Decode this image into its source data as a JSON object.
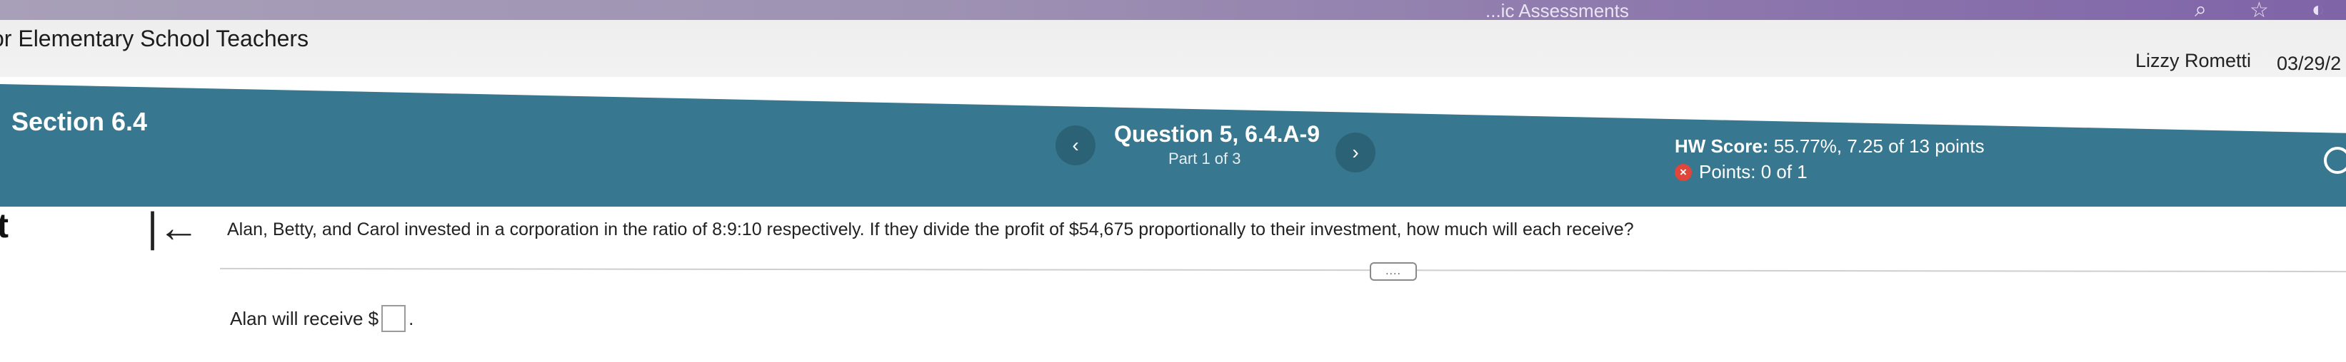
{
  "browser": {
    "tab_fragment": "...ic Assessments",
    "icons": [
      "search-icon",
      "star-icon",
      "extension-icon"
    ]
  },
  "header": {
    "course_title": "or Elementary School Teachers",
    "user_name": "Lizzy Rometti",
    "date": "03/29/2"
  },
  "quiz_bar": {
    "section": "Section 6.4",
    "question_title": "Question 5, 6.4.A-9",
    "part": "Part 1 of 3",
    "hw_score_label": "HW Score:",
    "hw_score_value": "55.77%, 7.25 of 13 points",
    "points": "Points: 0 of 1",
    "prev_glyph": "‹",
    "next_glyph": "›",
    "accent_color": "#37778f",
    "wrong_color": "#e0463a"
  },
  "content": {
    "left_edge_char": "t",
    "collapse_glyph": "|←",
    "question_text": "Alan, Betty, and Carol invested in a corporation in the ratio of 8:9:10 respectively. If they divide the profit of $54,675 proportionally to their investment, how much will each receive?",
    "more_label": "....",
    "answer_prefix": "Alan will receive $",
    "answer_suffix": ".",
    "answer_value": ""
  }
}
